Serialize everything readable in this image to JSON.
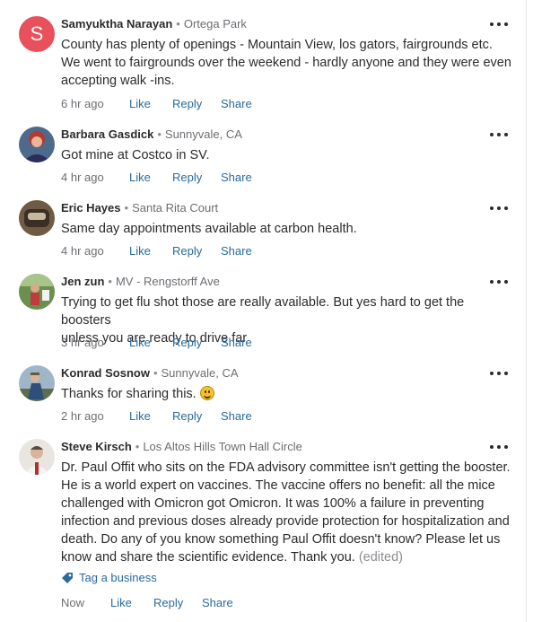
{
  "comments": [
    {
      "avatar_letter": "S",
      "name": "Samyuktha Narayan",
      "location": "Ortega Park",
      "lines": [
        "County has plenty of openings - Mountain View, los gators, fairgrounds etc.",
        "We went to fairgrounds over the weekend - hardly anyone and they were even",
        "accepting walk -ins."
      ],
      "time": "6 hr ago"
    },
    {
      "name": "Barbara Gasdick",
      "location": "Sunnyvale, CA",
      "lines": [
        "Got mine at Costco in SV."
      ],
      "time": "4 hr ago"
    },
    {
      "name": "Eric Hayes",
      "location": "Santa Rita Court",
      "lines": [
        "Same day appointments available at carbon health."
      ],
      "time": "4 hr ago"
    },
    {
      "name": "Jen zun",
      "location": "MV - Rengstorff Ave",
      "lines": [
        "Trying to get flu shot those are really available. But yes hard to get the boosters",
        "unless you are ready to drive far"
      ],
      "time": "3 hr ago"
    },
    {
      "name": "Konrad Sosnow",
      "location": "Sunnyvale, CA",
      "lines": [
        "Thanks for sharing this."
      ],
      "time": "2 hr ago"
    },
    {
      "name": "Steve Kirsch",
      "location": "Los Altos Hills Town Hall Circle",
      "lines": [
        "Dr. Paul Offit who sits on the FDA advisory committee isn't getting the booster.",
        "He is a world expert on vaccines. The vaccine offers no benefit: all the mice",
        "challenged with Omicron got Omicron. It was 100% a failure in preventing",
        "infection and previous doses already provide protection for hospitalization and",
        "death. Do any of you know something Paul Offit doesn't know? Please let us",
        "know and share the scientific evidence. Thank you."
      ],
      "edited_label": "(edited)",
      "tag_label": "Tag a business",
      "time": "Now"
    }
  ],
  "actions": {
    "like": "Like",
    "reply": "Reply",
    "share": "Share"
  },
  "colors": {
    "link": "#2a6a9b",
    "avatar_s": "#e8505b",
    "muted": "#6b6e72"
  },
  "icons": [
    "more-options-icon",
    "tag-icon",
    "smiley-emoji-icon"
  ]
}
